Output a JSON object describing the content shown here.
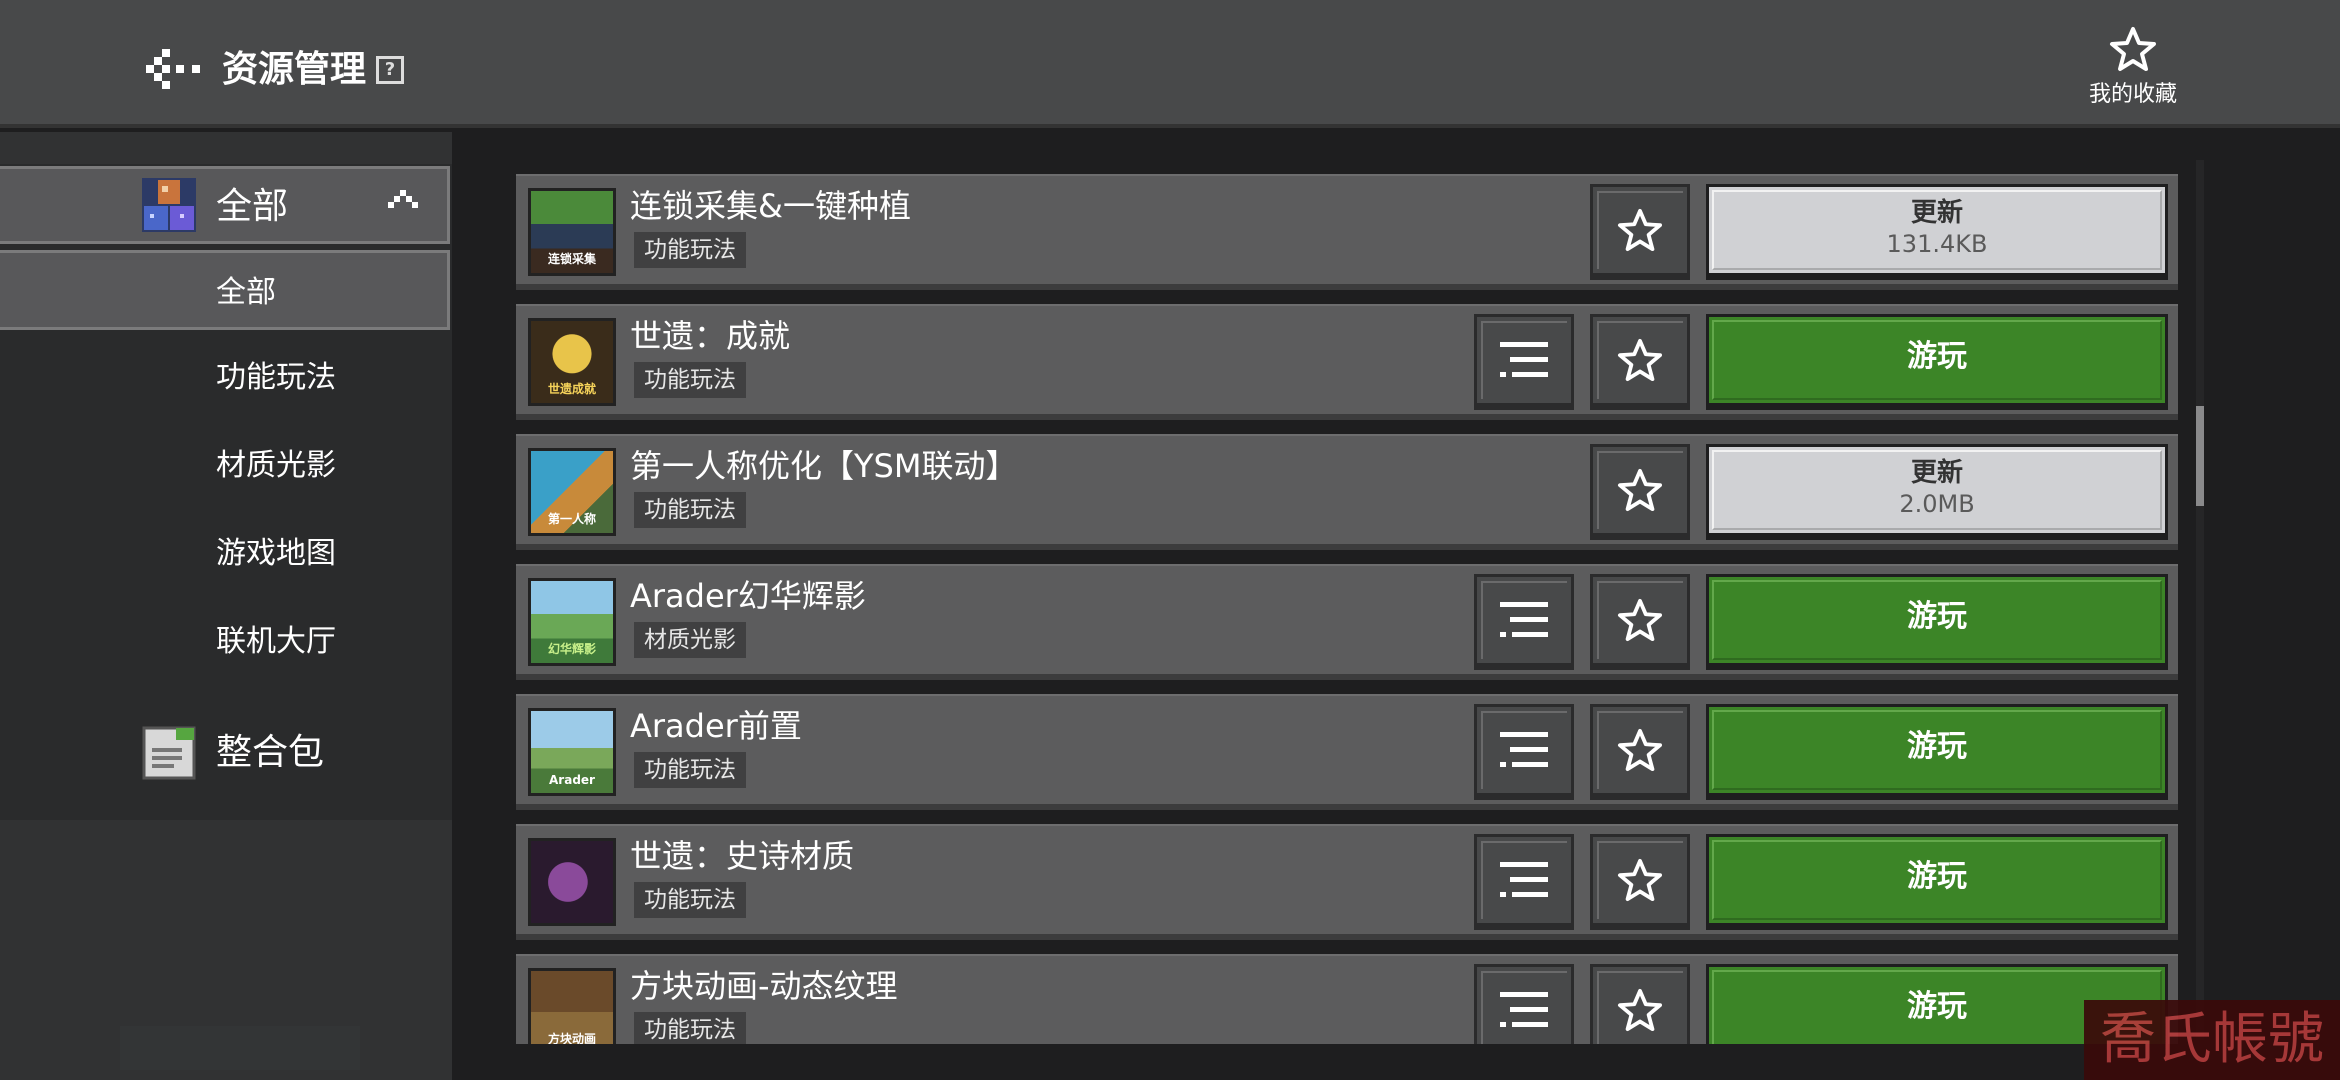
{
  "header": {
    "title": "资源管理",
    "help_icon": "?",
    "favorites_label": "我的收藏"
  },
  "sidebar": {
    "categories": [
      {
        "label": "全部",
        "icon": "blocks-icon",
        "expanded": true
      },
      {
        "label": "整合包",
        "icon": "document-icon",
        "expanded": false
      }
    ],
    "sub_items": [
      {
        "label": "全部",
        "selected": true
      },
      {
        "label": "功能玩法",
        "selected": false
      },
      {
        "label": "材质光影",
        "selected": false
      },
      {
        "label": "游戏地图",
        "selected": false
      },
      {
        "label": "联机大厅",
        "selected": false
      }
    ]
  },
  "items": [
    {
      "title": "连锁采集&一键种植",
      "tag": "功能玩法",
      "action": "更新",
      "size": "131.4KB",
      "has_list_button": false,
      "thumb_text": "连锁采集"
    },
    {
      "title": "世遗：成就",
      "tag": "功能玩法",
      "action": "游玩",
      "has_list_button": true,
      "thumb_text": "世遗成就"
    },
    {
      "title": "第一人称优化【YSM联动】",
      "tag": "功能玩法",
      "action": "更新",
      "size": "2.0MB",
      "has_list_button": false,
      "thumb_text": "第一人称"
    },
    {
      "title": "Arader幻华辉影",
      "tag": "材质光影",
      "action": "游玩",
      "has_list_button": true,
      "thumb_text": "幻华辉影"
    },
    {
      "title": "Arader前置",
      "tag": "功能玩法",
      "action": "游玩",
      "has_list_button": true,
      "thumb_text": "Arader"
    },
    {
      "title": "世遗：史诗材质",
      "tag": "功能玩法",
      "action": "游玩",
      "has_list_button": true,
      "thumb_text": ""
    },
    {
      "title": "方块动画-动态纹理",
      "tag": "功能玩法",
      "action": "游玩",
      "has_list_button": true,
      "thumb_text": "方块动画"
    }
  ],
  "colors": {
    "play_button": "#3c8527",
    "update_button": "#d0d1d4",
    "header_bg": "#48494a",
    "row_bg": "#5c5c5d"
  },
  "watermark": "喬氏帳號"
}
